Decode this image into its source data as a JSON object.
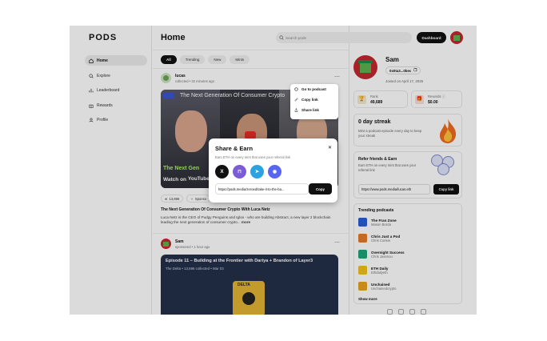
{
  "app": {
    "logo": "PODS",
    "page_title": "Home"
  },
  "sidebar": {
    "items": [
      {
        "label": "Home",
        "icon": "home-icon",
        "active": true
      },
      {
        "label": "Explore",
        "icon": "search-icon"
      },
      {
        "label": "Leaderboard",
        "icon": "bar-chart-icon"
      },
      {
        "label": "Rewards",
        "icon": "gift-icon"
      },
      {
        "label": "Profile",
        "icon": "user-icon"
      }
    ]
  },
  "header": {
    "search_placeholder": "Search pods",
    "dashboard_label": "Dashboard"
  },
  "filters": [
    "All",
    "Trending",
    "New",
    "Mints"
  ],
  "post1": {
    "author": "lucas",
    "meta": "collected • 32 minutes ago",
    "thumb_title": "The Next Generation Of Consumer Crypto",
    "thumb_overlay_1": "The Next Gen",
    "thumb_overlay_2": "Watch on",
    "youtube": "YouTube",
    "collected": "13,696",
    "sponsor": "Sponso",
    "title": "The Next Generation Of Consumer Crypto With Luca Netz",
    "desc": "Luca Netz is the CEO of Pudgy Penguins and Igloo - who are building Abstract, a new layer 2 blockchain leading the next generation of consumer crypto...",
    "more": "more"
  },
  "post2": {
    "author": "Sam",
    "meta": "sponsored • 1 hour ago",
    "episode": "Episode 11 – Building at the Frontier with Dariya + Brandon of Layer3",
    "show": "The Delta",
    "collected": "13,696 collected",
    "date": "Mar 03",
    "badge": "DELTA"
  },
  "menu": {
    "items": [
      {
        "label": "Go to podcast",
        "icon": "podcast-icon"
      },
      {
        "label": "Copy link",
        "icon": "link-icon"
      },
      {
        "label": "Share link",
        "icon": "share-icon"
      }
    ]
  },
  "share": {
    "title": "Share & Earn",
    "subtitle": "Earn ETH on every mint that uses your referral link",
    "link": "https://pods.media/zeroed/take-it-to-the-ba...",
    "copy": "Copy",
    "buttons": [
      {
        "name": "x",
        "glyph": "X",
        "color": "#111111"
      },
      {
        "name": "farcaster",
        "glyph": "⊓",
        "color": "#7c5cd6"
      },
      {
        "name": "telegram",
        "glyph": "➤",
        "color": "#2aa3e0"
      },
      {
        "name": "discord",
        "glyph": "◉",
        "color": "#5865f2"
      }
    ]
  },
  "profile": {
    "name": "Sam",
    "address": "0x0ta3...0bec",
    "joined": "Joined on April 17, 2025",
    "rank_label": "Rank",
    "rank": "49,689",
    "rewards_label": "Rewards",
    "rewards": "$0.00"
  },
  "streak": {
    "title": "0 day streak",
    "desc": "Mint a podcast episode every day to keep your streak"
  },
  "refer": {
    "title": "Refer friends & Earn",
    "desc": "Earn ETH on every mint that uses your referral link",
    "link": "https://www.pods.media/lucas.eth",
    "copy": "Copy link"
  },
  "trending": {
    "title": "Trending podcasts",
    "items": [
      {
        "name": "The Fran Zone",
        "author": "Mason Borda",
        "color": "#2a5fd6"
      },
      {
        "name": "Chris Just a Pod",
        "author": "Chris Corleie",
        "color": "#e57b2a"
      },
      {
        "name": "Overnight Success",
        "author": "Chris Jasenou",
        "color": "#1fa37a"
      },
      {
        "name": "ETH Daily",
        "author": "Ethdailyeth",
        "color": "#f2c31a"
      },
      {
        "name": "Unchained",
        "author": "Unchainedcrypto",
        "color": "#e8a21c"
      }
    ],
    "show_more": "Show more"
  },
  "colors": {
    "accent": "#111111",
    "streak_fire": "#f06a1f"
  }
}
